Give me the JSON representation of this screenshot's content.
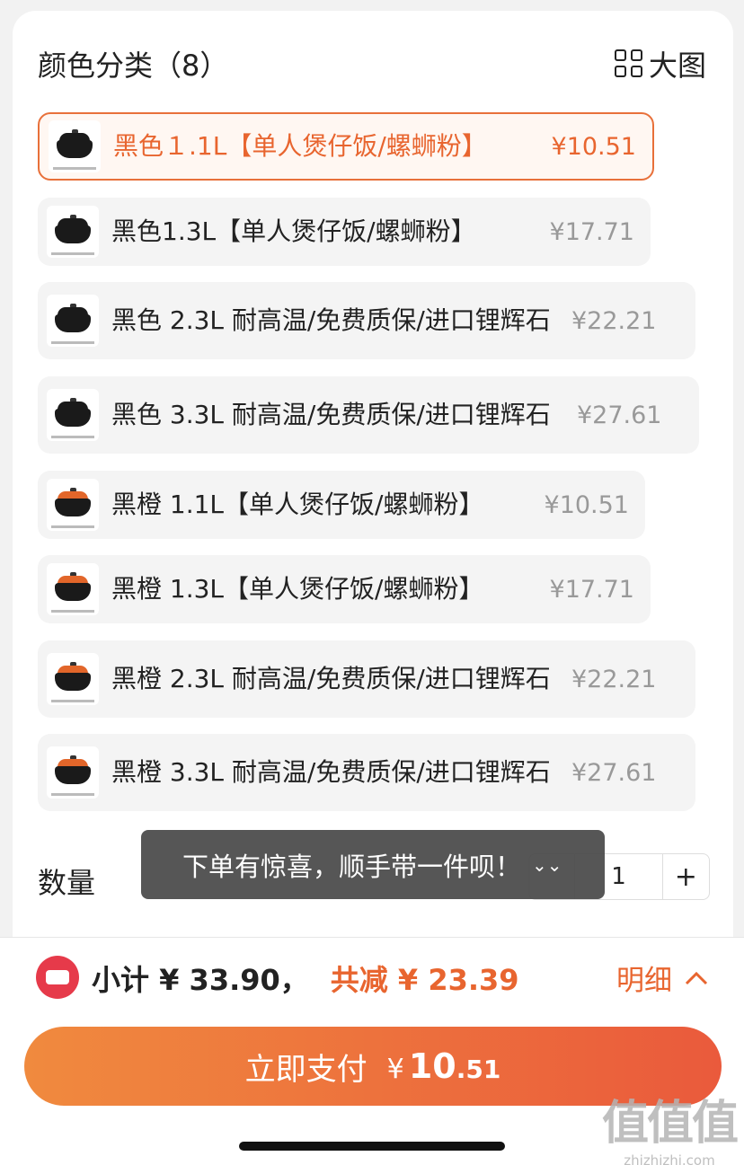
{
  "section": {
    "title": "颜色分类（8）",
    "big_image_label": "大图"
  },
  "skus": [
    {
      "name": "黑色１.1L【单人煲仔饭/螺蛳粉】",
      "price": "¥10.51",
      "lid": "black",
      "selected": true
    },
    {
      "name": "黑色1.3L【单人煲仔饭/螺蛳粉】",
      "price": "¥17.71",
      "lid": "black",
      "selected": false
    },
    {
      "name": "黑色 2.3L 耐高温/免费质保/进口锂辉石",
      "price": "¥22.21",
      "lid": "black",
      "selected": false
    },
    {
      "name": "黑色 3.3L 耐高温/免费质保/进口锂辉石",
      "price": "¥27.61",
      "lid": "black",
      "selected": false
    },
    {
      "name": "黑橙 1.1L【单人煲仔饭/螺蛳粉】",
      "price": "¥10.51",
      "lid": "orange",
      "selected": false
    },
    {
      "name": "黑橙 1.3L【单人煲仔饭/螺蛳粉】",
      "price": "¥17.71",
      "lid": "orange",
      "selected": false
    },
    {
      "name": "黑橙 2.3L 耐高温/免费质保/进口锂辉石",
      "price": "¥22.21",
      "lid": "orange",
      "selected": false
    },
    {
      "name": "黑橙 3.3L 耐高温/免费质保/进口锂辉石",
      "price": "¥27.61",
      "lid": "orange",
      "selected": false
    }
  ],
  "quantity": {
    "label": "数量",
    "value": "1",
    "plus": "+"
  },
  "toast": {
    "text": "下单有惊喜，顺手带一件呗！",
    "icon": "double-chevron-down-icon"
  },
  "summary": {
    "subtotal": "小计 ¥ 33.90，",
    "discount": "共减 ¥ 23.39",
    "detail_label": "明细"
  },
  "pay": {
    "label": "立即支付",
    "currency": "¥",
    "amount_int": "10",
    "amount_dec": ".51"
  },
  "watermark": {
    "big": "值值值",
    "small": "zhizhizhi.com"
  },
  "colors": {
    "accent": "#e8652f",
    "badge": "#e63a4a"
  }
}
